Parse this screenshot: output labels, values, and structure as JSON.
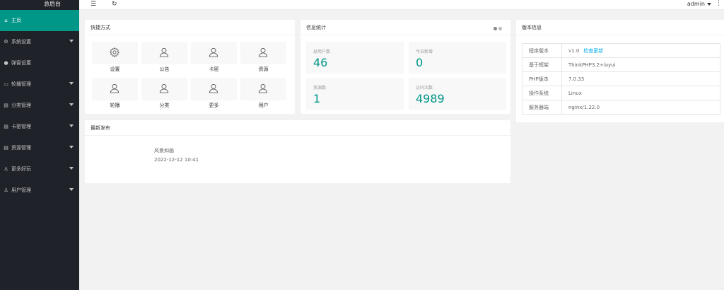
{
  "app": {
    "title": "总后台"
  },
  "sidebar": {
    "items": [
      {
        "label": "主页",
        "icon": "home-icon",
        "glyph": "⌂",
        "active": true,
        "has_caret": false
      },
      {
        "label": "系统设置",
        "icon": "gear-icon",
        "glyph": "⚙",
        "active": false,
        "has_caret": true
      },
      {
        "label": "弹窗设置",
        "icon": "dot-icon",
        "glyph": "●",
        "active": false,
        "has_caret": false
      },
      {
        "label": "轮播管理",
        "icon": "image-icon",
        "glyph": "▭",
        "active": false,
        "has_caret": true
      },
      {
        "label": "分类管理",
        "icon": "list-icon",
        "glyph": "▤",
        "active": false,
        "has_caret": true
      },
      {
        "label": "卡密管理",
        "icon": "list-icon",
        "glyph": "▤",
        "active": false,
        "has_caret": true
      },
      {
        "label": "资源管理",
        "icon": "list-icon",
        "glyph": "▤",
        "active": false,
        "has_caret": true
      },
      {
        "label": "更多好玩",
        "icon": "user-icon",
        "glyph": "♙",
        "active": false,
        "has_caret": true
      },
      {
        "label": "用户管理",
        "icon": "user-icon",
        "glyph": "♙",
        "active": false,
        "has_caret": true
      }
    ]
  },
  "topbar": {
    "menu_glyph": "☰",
    "refresh_glyph": "↻",
    "user": "admin",
    "more_glyph": "⋮"
  },
  "quick": {
    "title": "快捷方式",
    "items": [
      {
        "label": "设置",
        "icon": "gear-icon"
      },
      {
        "label": "公告",
        "icon": "user-icon"
      },
      {
        "label": "卡密",
        "icon": "user-icon"
      },
      {
        "label": "资源",
        "icon": "user-icon"
      },
      {
        "label": "轮播",
        "icon": "user-icon"
      },
      {
        "label": "分类",
        "icon": "user-icon"
      },
      {
        "label": "更多",
        "icon": "user-icon"
      },
      {
        "label": "用户",
        "icon": "user-icon"
      }
    ]
  },
  "stats": {
    "title": "信息统计",
    "items": [
      {
        "label": "总用户数",
        "value": "46"
      },
      {
        "label": "今日新增",
        "value": "0"
      },
      {
        "label": "资源数",
        "value": "1"
      },
      {
        "label": "访问次数",
        "value": "4989"
      }
    ]
  },
  "version": {
    "title": "版本信息",
    "rows": [
      {
        "key": "程序版本",
        "value": "v1.0",
        "link": "检查更新"
      },
      {
        "key": "基于框架",
        "value": "ThinkPHP3.2+layui"
      },
      {
        "key": "PHP版本",
        "value": "7.0.33"
      },
      {
        "key": "操作系统",
        "value": "Linux"
      },
      {
        "key": "服务器端",
        "value": "nginx/1.22.0"
      }
    ]
  },
  "latest": {
    "title": "最新发布",
    "post_title": "风景如画",
    "post_date": "2022-12-12 10:41"
  },
  "colors": {
    "accent": "#009688",
    "sidebar": "#20222a",
    "link": "#01AAED"
  }
}
